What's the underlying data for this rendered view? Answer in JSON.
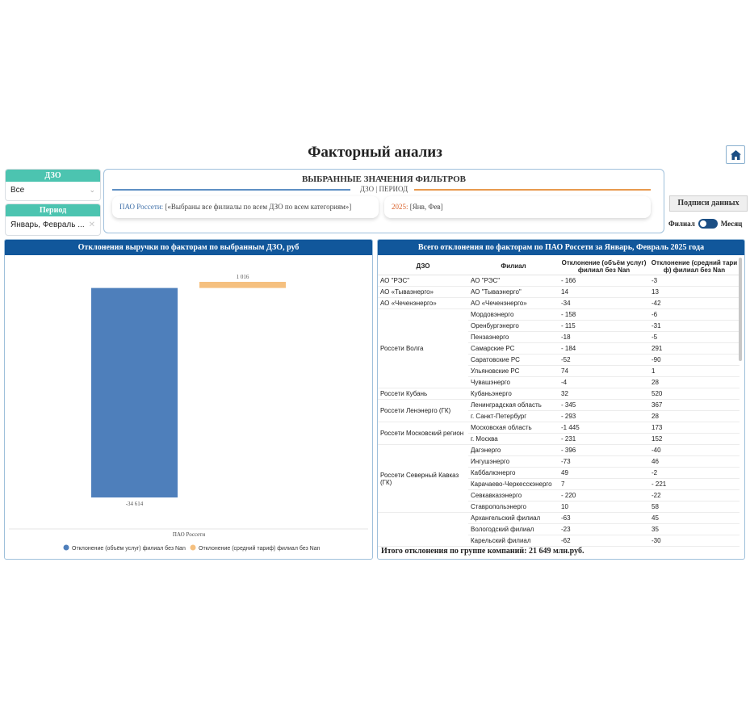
{
  "page": {
    "title": "Факторный анализ"
  },
  "slicers": {
    "dzo": {
      "label": "ДЗО",
      "value": "Все"
    },
    "period": {
      "label": "Период",
      "value": "Январь, Февраль ..."
    }
  },
  "filters": {
    "title": "ВЫБРАННЫЕ ЗНАЧЕНИЯ ФИЛЬТРОВ",
    "subtitle": "ДЗО | ПЕРИОД",
    "dzo_key": "ПАО Россети:",
    "dzo_value": "[«Выбраны все филиалы по всем ДЗО по всем категориям»]",
    "period_key": "2025:",
    "period_value": "[Янв, Фев]"
  },
  "controls": {
    "data_labels_button": "Подписи данных",
    "toggle_left": "Филиал",
    "toggle_right": "Месяц"
  },
  "colors": {
    "accent_teal": "#4cc4b0",
    "header_blue": "#11579b",
    "series_volume": "#4e7fbb",
    "series_tariff": "#f5c07f",
    "rule_blue": "#5f8fc4",
    "rule_orange": "#e89a4e",
    "period_key": "#d9622b",
    "dzo_key": "#3e6fa8"
  },
  "left_panel": {
    "title": "Отклонения выручки по факторам по выбранным ДЗО, руб"
  },
  "chart_data": {
    "type": "bar",
    "categories": [
      "ПАО Россети"
    ],
    "series": [
      {
        "name": "Отклонение (объём услуг) филиал без Nan",
        "values": [
          -34614
        ],
        "labels": [
          "-34 614"
        ]
      },
      {
        "name": "Отклонение (средний тариф) филиал без Nan",
        "values": [
          1016
        ],
        "labels": [
          "1 016"
        ]
      }
    ],
    "title": "",
    "xlabel": "",
    "ylabel": "",
    "ylim": [
      -34614,
      1016
    ],
    "grid": false,
    "legend": "bottom"
  },
  "table_panel": {
    "title": "Всего отклонения по факторам по ПАО Россети за Январь, Февраль 2025 года",
    "columns": [
      "ДЗО",
      "Филиал",
      "Отклонение (объём услуг) филиал без Nan",
      "Отклонение (средний тари ф) филиал без Nan"
    ],
    "groups": [
      {
        "dzo": "АО \"РЭС\"",
        "rows": [
          [
            "АО \"РЭС\"",
            "- 166",
            "-3"
          ]
        ]
      },
      {
        "dzo": "АО «Тываэнерго»",
        "rows": [
          [
            "АО \"Тываэнерго\"",
            "14",
            "13"
          ]
        ]
      },
      {
        "dzo": "АО «Чеченэнерго»",
        "rows": [
          [
            "АО «Чеченэнерго»",
            "-34",
            "-42"
          ]
        ]
      },
      {
        "dzo": "Россети Волга",
        "rows": [
          [
            "Мордовэнерго",
            "- 158",
            "-6"
          ],
          [
            "Оренбургэнерго",
            "- 115",
            "-31"
          ],
          [
            "Пензаэнерго",
            "-18",
            "-5"
          ],
          [
            "Самарские РС",
            "- 184",
            "291"
          ],
          [
            "Саратовские РС",
            "-52",
            "-90"
          ],
          [
            "Ульяновские РС",
            "74",
            "1"
          ],
          [
            "Чувашэнерго",
            "-4",
            "28"
          ]
        ]
      },
      {
        "dzo": "Россети Кубань",
        "rows": [
          [
            "Кубаньэнерго",
            "32",
            "520"
          ]
        ]
      },
      {
        "dzo": "Россети Ленэнерго (ГК)",
        "rows": [
          [
            "Ленинградская область",
            "- 345",
            "367"
          ],
          [
            "г. Санкт-Петербург",
            "- 293",
            "28"
          ]
        ]
      },
      {
        "dzo": "Россети Московский регион",
        "rows": [
          [
            "Московская область",
            "-1 445",
            "173"
          ],
          [
            "г. Москва",
            "- 231",
            "152"
          ]
        ]
      },
      {
        "dzo": "Россети Северный Кавказ (ГК)",
        "rows": [
          [
            "Дагэнерго",
            "- 396",
            "-40"
          ],
          [
            "Ингушэнерго",
            "-73",
            "46"
          ],
          [
            "Каббалкэнерго",
            "49",
            "-2"
          ],
          [
            "Карачаево-Черкесскэнерго",
            "7",
            "- 221"
          ],
          [
            "Севкавказэнерго",
            "- 220",
            "-22"
          ],
          [
            "Ставропольэнерго",
            "10",
            "58"
          ]
        ]
      },
      {
        "dzo": "",
        "rows": [
          [
            "Архангельский филиал",
            "-63",
            "45"
          ],
          [
            "Вологодский филиал",
            "-23",
            "35"
          ],
          [
            "Карельский филиал",
            "-62",
            "-30"
          ]
        ]
      }
    ],
    "total": "Итого отклонения по группе компаний: 21 649 млн.руб."
  }
}
